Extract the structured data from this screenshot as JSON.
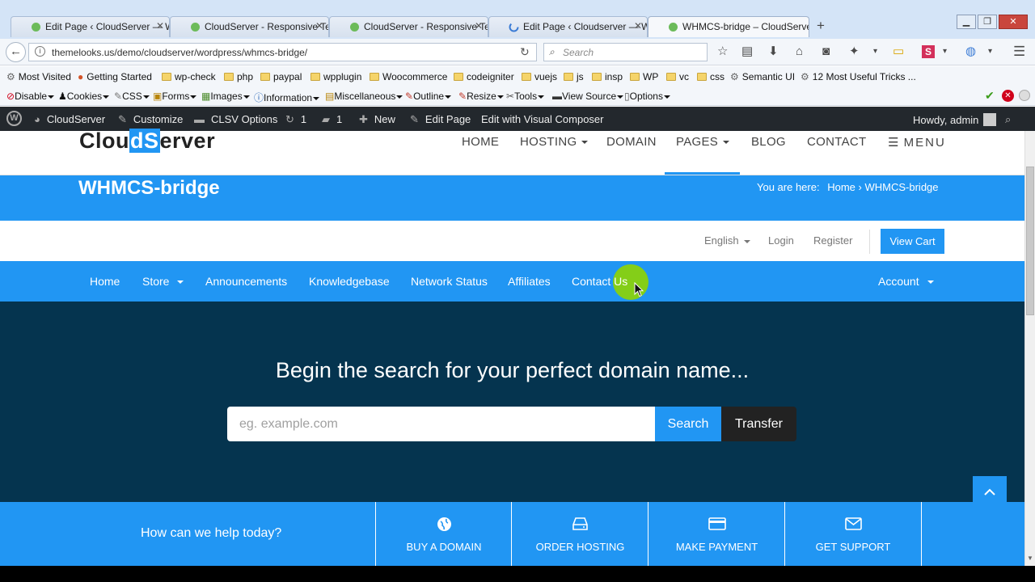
{
  "browser": {
    "tabs": [
      {
        "title": "Edit Page ‹ CloudServer — W"
      },
      {
        "title": "CloudServer - Responsive Te"
      },
      {
        "title": "CloudServer - Responsive Te"
      },
      {
        "title": "Edit Page ‹ Cloudserver — W"
      },
      {
        "title": "WHMCS-bridge – CloudServe"
      }
    ],
    "new_tab": "+",
    "url": "themelooks.us/demo/cloudserver/wordpress/whmcs-bridge/",
    "search_placeholder": "Search"
  },
  "bookmarks": [
    "Most Visited",
    "Getting Started",
    "wp-check",
    "php",
    "paypal",
    "wpplugin",
    "Woocommerce",
    "codeigniter",
    "vuejs",
    "js",
    "insp",
    "WP",
    "vc",
    "css",
    "Semantic UI",
    "12 Most Useful Tricks ..."
  ],
  "devtoolbar": [
    "Disable",
    "Cookies",
    "CSS",
    "Forms",
    "Images",
    "Information",
    "Miscellaneous",
    "Outline",
    "Resize",
    "Tools",
    "View Source",
    "Options"
  ],
  "wpadmin": {
    "site": "CloudServer",
    "customize": "Customize",
    "clsv": "CLSV Options",
    "updates": "1",
    "comments": "1",
    "new": "New",
    "edit": "Edit Page",
    "vc": "Edit with Visual Composer",
    "howdy": "Howdy, admin"
  },
  "site": {
    "logo_a": "Clou",
    "logo_b": "dS",
    "logo_c": "erver",
    "nav": [
      "HOME",
      "HOSTING",
      "DOMAIN",
      "PAGES",
      "BLOG",
      "CONTACT"
    ],
    "menu": "MENU",
    "page_title": "WHMCS-bridge",
    "breadcrumb_prefix": "You are here:",
    "breadcrumb_home": "Home",
    "breadcrumb_sep": "›",
    "breadcrumb_current": "WHMCS-bridge"
  },
  "whmcs": {
    "language": "English",
    "login": "Login",
    "register": "Register",
    "view_cart": "View Cart",
    "nav": [
      "Home",
      "Store",
      "Announcements",
      "Knowledgebase",
      "Network Status",
      "Affiliates",
      "Contact Us"
    ],
    "account": "Account",
    "hero_title": "Begin the search for your perfect domain name...",
    "domain_placeholder": "eg. example.com",
    "search_btn": "Search",
    "transfer_btn": "Transfer",
    "help_text": "How can we help today?",
    "help_items": [
      "BUY A DOMAIN",
      "ORDER HOSTING",
      "MAKE PAYMENT",
      "GET SUPPORT"
    ]
  },
  "colors": {
    "primary": "#2196f3",
    "hero_bg": "#05344f",
    "wpbar": "#23282d",
    "cursor_highlight": "#8fd400"
  }
}
